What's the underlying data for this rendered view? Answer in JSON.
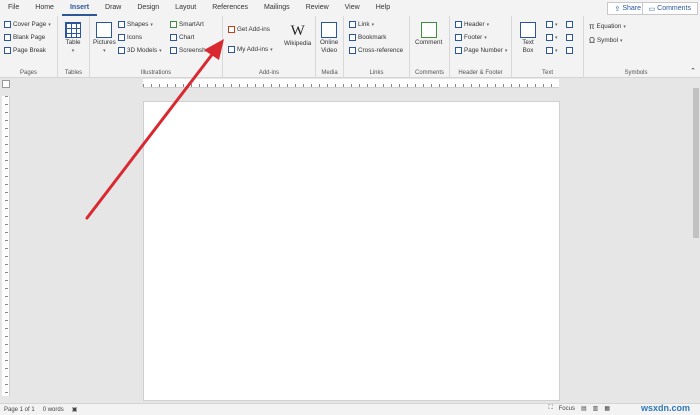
{
  "menu": {
    "tabs": [
      "File",
      "Home",
      "Insert",
      "Draw",
      "Design",
      "Layout",
      "References",
      "Mailings",
      "Review",
      "View",
      "Help"
    ],
    "active": "Insert",
    "share_label": "Share",
    "comments_label": "Comments"
  },
  "ribbon": {
    "pages": {
      "label": "Pages",
      "items": [
        "Cover Page",
        "Blank Page",
        "Page Break"
      ]
    },
    "tables": {
      "label": "Tables",
      "table": "Table"
    },
    "illustrations": {
      "label": "Illustrations",
      "pictures": "Pictures",
      "shapes": "Shapes",
      "icons": "Icons",
      "models3d": "3D Models",
      "smartart": "SmartArt",
      "chart": "Chart",
      "screenshot": "Screenshot"
    },
    "addins": {
      "label": "Add-ins",
      "get": "Get Add-ins",
      "my": "My Add-ins",
      "wikipedia": "Wikipedia",
      "wiki_glyph": "W"
    },
    "media": {
      "label": "Media",
      "online_video_line1": "Online",
      "online_video_line2": "Video"
    },
    "links": {
      "label": "Links",
      "link": "Link",
      "bookmark": "Bookmark",
      "crossref": "Cross-reference"
    },
    "comments": {
      "label": "Comments",
      "comment": "Comment"
    },
    "header_footer": {
      "label": "Header & Footer",
      "header": "Header",
      "footer": "Footer",
      "page_number": "Page Number"
    },
    "text": {
      "label": "Text",
      "textbox_line1": "Text",
      "textbox_line2": "Box"
    },
    "symbols": {
      "label": "Symbols",
      "equation": "Equation",
      "symbol": "Symbol"
    }
  },
  "status": {
    "page": "Page 1 of 1",
    "words": "0 words",
    "focus": "Focus"
  },
  "watermark": "wsxdn.com",
  "colors": {
    "accent": "#2b579a",
    "arrow": "#d9282f"
  }
}
